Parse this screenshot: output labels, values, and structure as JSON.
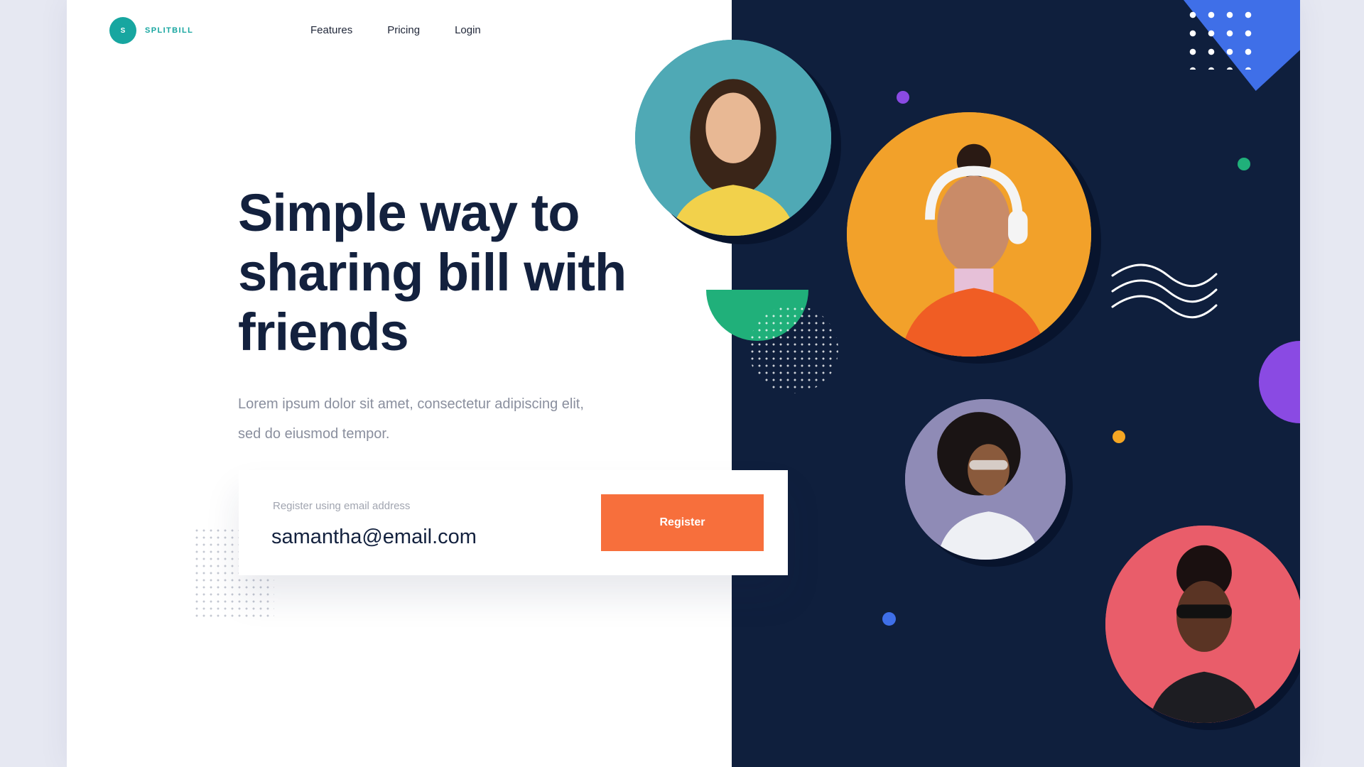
{
  "brand": {
    "mark": "S",
    "name": "SPLITBILL"
  },
  "nav": [
    {
      "label": "Features"
    },
    {
      "label": "Pricing"
    },
    {
      "label": "Login"
    }
  ],
  "hero": {
    "headline": "Simple way to sharing bill with friends",
    "subtext": "Lorem ipsum dolor sit amet, consectetur adipiscing elit, sed do eiusmod tempor."
  },
  "signup": {
    "field_label": "Register using email address",
    "email_value": "samantha@email.com",
    "button_label": "Register"
  },
  "colors": {
    "accent_teal": "#17a6a0",
    "navy": "#0f1f3d",
    "cta_orange": "#f76f3c",
    "green": "#20b07a",
    "blue": "#3f6fe8",
    "purple": "#8a4ae3"
  }
}
